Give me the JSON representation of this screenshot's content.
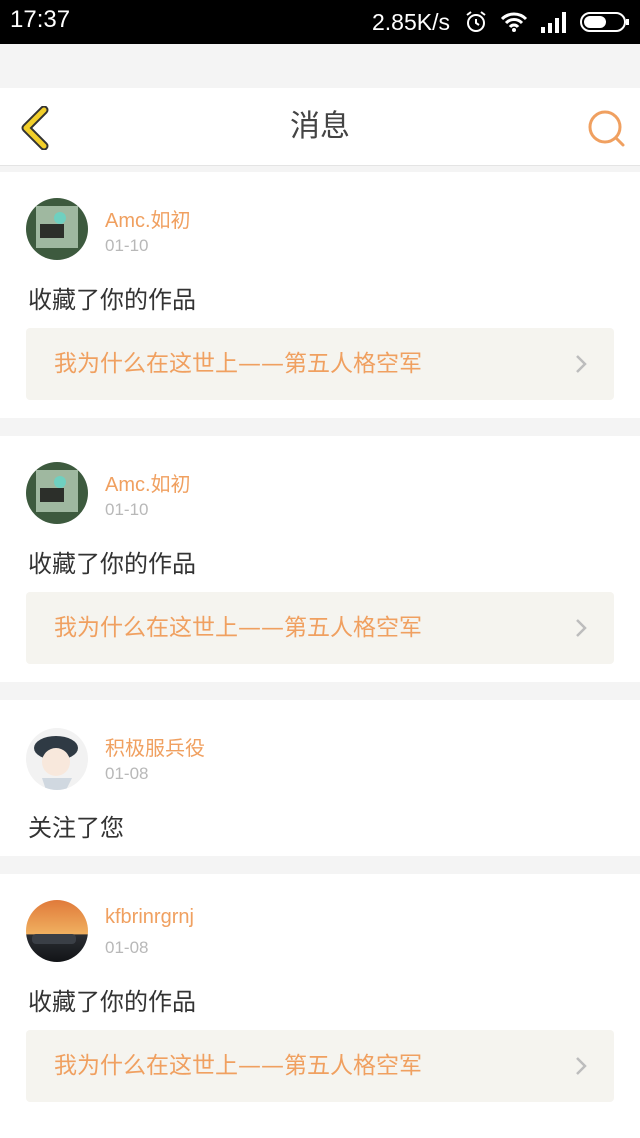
{
  "status_bar": {
    "time": "17:37",
    "net_speed": "2.85K/s",
    "icons": [
      "alarm-icon",
      "wifi-icon",
      "signal-icon",
      "battery-icon"
    ]
  },
  "header": {
    "title": "消息",
    "back_icon": "chevron-left-icon",
    "search_icon": "search-icon"
  },
  "colors": {
    "accent": "#f0a060",
    "back_arrow": "#f2cf2b",
    "card_bg": "#ffffff",
    "page_bg": "#f4f4f4",
    "work_bg": "#f5f4ef"
  },
  "messages": [
    {
      "user": "Amc.如初",
      "date": "01-10",
      "action": "收藏了你的作品",
      "work_title": "我为什么在这世上——第五人格空军"
    },
    {
      "user": "Amc.如初",
      "date": "01-10",
      "action": "收藏了你的作品",
      "work_title": "我为什么在这世上——第五人格空军"
    },
    {
      "user": "积极服兵役",
      "date": "01-08",
      "action": "关注了您"
    },
    {
      "user": "kfbrinrgrnj",
      "date": "01-08",
      "action": "收藏了你的作品",
      "work_title": "我为什么在这世上——第五人格空军"
    }
  ]
}
